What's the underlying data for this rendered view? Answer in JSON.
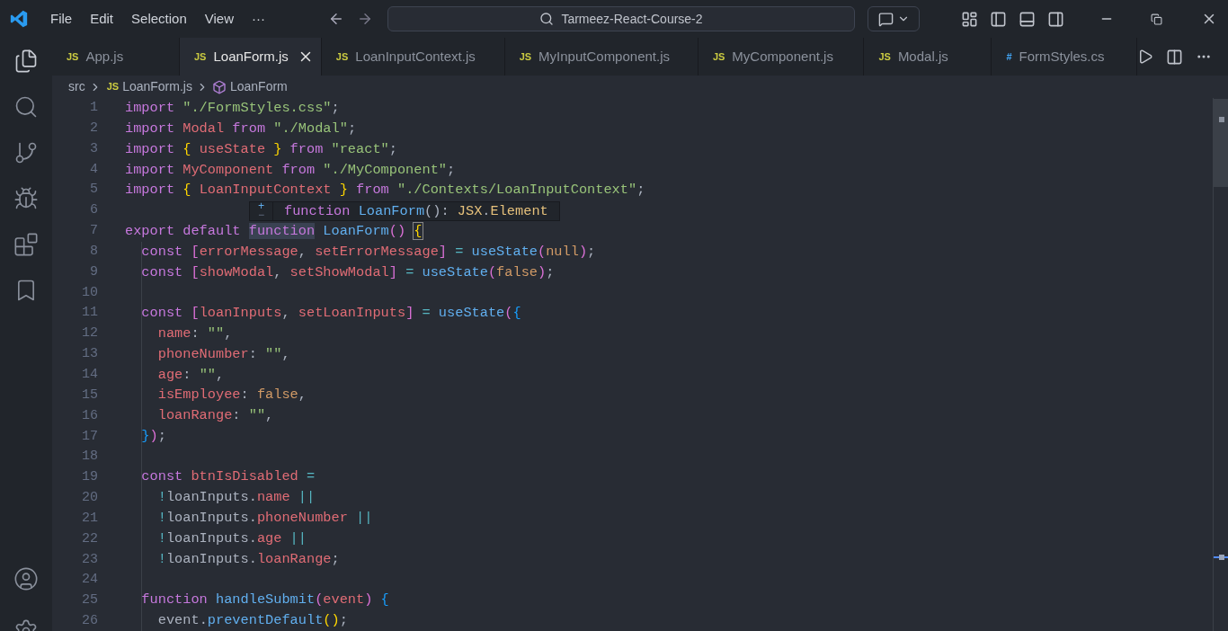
{
  "menu": [
    "File",
    "Edit",
    "Selection",
    "View",
    "···"
  ],
  "command_center": {
    "text": "Tarmeez-React-Course-2"
  },
  "tabs": [
    {
      "icon_text": "JS",
      "kind": "js",
      "label": "App.js",
      "selected": false
    },
    {
      "icon_text": "JS",
      "kind": "js",
      "label": "LoanForm.js",
      "selected": true
    },
    {
      "icon_text": "JS",
      "kind": "js",
      "label": "LoanInputContext.js",
      "selected": false
    },
    {
      "icon_text": "JS",
      "kind": "js",
      "label": "MyInputComponent.js",
      "selected": false
    },
    {
      "icon_text": "JS",
      "kind": "js",
      "label": "MyComponent.js",
      "selected": false
    },
    {
      "icon_text": "JS",
      "kind": "js",
      "label": "Modal.js",
      "selected": false
    },
    {
      "icon_text": "#",
      "kind": "css",
      "label": "FormStyles.cs",
      "selected": false
    }
  ],
  "breadcrumb": {
    "folder": "src",
    "file_icon": "JS",
    "file": "LoanForm.js",
    "symbol": "LoanForm"
  },
  "hover": {
    "plus": "+",
    "minus": "−",
    "tokens": [
      {
        "text": "function ",
        "kind": "keyword"
      },
      {
        "text": "LoanForm",
        "kind": "function"
      },
      {
        "text": "(): ",
        "kind": "plain"
      },
      {
        "text": "JSX",
        "kind": "type"
      },
      {
        "text": ".",
        "kind": "plain"
      },
      {
        "text": "Element",
        "kind": "type"
      }
    ]
  },
  "lines": [
    {
      "number": "1",
      "tokens": [
        {
          "text": "import ",
          "kind": "keyword"
        },
        {
          "text": "\"./FormStyles.css\"",
          "kind": "string"
        },
        {
          "text": ";",
          "kind": "plain"
        }
      ]
    },
    {
      "number": "2",
      "tokens": [
        {
          "text": "import ",
          "kind": "keyword"
        },
        {
          "text": "Modal ",
          "kind": "variable"
        },
        {
          "text": "from ",
          "kind": "keyword"
        },
        {
          "text": "\"./Modal\"",
          "kind": "string"
        },
        {
          "text": ";",
          "kind": "plain"
        }
      ]
    },
    {
      "number": "3",
      "tokens": [
        {
          "text": "import ",
          "kind": "keyword"
        },
        {
          "text": "{ ",
          "kind": "bracket1"
        },
        {
          "text": "useState ",
          "kind": "variable"
        },
        {
          "text": "} ",
          "kind": "bracket1"
        },
        {
          "text": "from ",
          "kind": "keyword"
        },
        {
          "text": "\"react\"",
          "kind": "string"
        },
        {
          "text": ";",
          "kind": "plain"
        }
      ]
    },
    {
      "number": "4",
      "tokens": [
        {
          "text": "import ",
          "kind": "keyword"
        },
        {
          "text": "MyComponent ",
          "kind": "variable"
        },
        {
          "text": "from ",
          "kind": "keyword"
        },
        {
          "text": "\"./MyComponent\"",
          "kind": "string"
        },
        {
          "text": ";",
          "kind": "plain"
        }
      ]
    },
    {
      "number": "5",
      "tokens": [
        {
          "text": "import ",
          "kind": "keyword"
        },
        {
          "text": "{ ",
          "kind": "bracket1"
        },
        {
          "text": "LoanInputContext ",
          "kind": "variable"
        },
        {
          "text": "} ",
          "kind": "bracket1"
        },
        {
          "text": "from ",
          "kind": "keyword"
        },
        {
          "text": "\"./Contexts/LoanInputContext\"",
          "kind": "string"
        },
        {
          "text": ";",
          "kind": "plain"
        }
      ]
    },
    {
      "number": "6"
    },
    {
      "number": "7",
      "tokens": [
        {
          "text": "export ",
          "kind": "keyword"
        },
        {
          "text": "default ",
          "kind": "keyword"
        },
        {
          "text": "function",
          "kind": "keyword",
          "highlighted": true
        },
        {
          "text": " LoanForm",
          "kind": "function"
        },
        {
          "text": "() ",
          "kind": "bracket2"
        },
        {
          "text": "{",
          "kind": "bracket1",
          "matched": true
        }
      ]
    },
    {
      "number": "8",
      "tokens": [
        {
          "text": "  const ",
          "kind": "keyword"
        },
        {
          "text": "[",
          "kind": "bracket2"
        },
        {
          "text": "errorMessage",
          "kind": "variable"
        },
        {
          "text": ", ",
          "kind": "plain"
        },
        {
          "text": "setErrorMessage",
          "kind": "variable"
        },
        {
          "text": "] ",
          "kind": "bracket2"
        },
        {
          "text": "= ",
          "kind": "operator"
        },
        {
          "text": "useState",
          "kind": "function"
        },
        {
          "text": "(",
          "kind": "bracket2"
        },
        {
          "text": "null",
          "kind": "constant"
        },
        {
          "text": ")",
          "kind": "bracket2"
        },
        {
          "text": ";",
          "kind": "plain"
        }
      ]
    },
    {
      "number": "9",
      "tokens": [
        {
          "text": "  const ",
          "kind": "keyword"
        },
        {
          "text": "[",
          "kind": "bracket2"
        },
        {
          "text": "showModal",
          "kind": "variable"
        },
        {
          "text": ", ",
          "kind": "plain"
        },
        {
          "text": "setShowModal",
          "kind": "variable"
        },
        {
          "text": "] ",
          "kind": "bracket2"
        },
        {
          "text": "= ",
          "kind": "operator"
        },
        {
          "text": "useState",
          "kind": "function"
        },
        {
          "text": "(",
          "kind": "bracket2"
        },
        {
          "text": "false",
          "kind": "constant"
        },
        {
          "text": ")",
          "kind": "bracket2"
        },
        {
          "text": ";",
          "kind": "plain"
        }
      ]
    },
    {
      "number": "10"
    },
    {
      "number": "11",
      "tokens": [
        {
          "text": "  const ",
          "kind": "keyword"
        },
        {
          "text": "[",
          "kind": "bracket2"
        },
        {
          "text": "loanInputs",
          "kind": "variable"
        },
        {
          "text": ", ",
          "kind": "plain"
        },
        {
          "text": "setLoanInputs",
          "kind": "variable"
        },
        {
          "text": "] ",
          "kind": "bracket2"
        },
        {
          "text": "= ",
          "kind": "operator"
        },
        {
          "text": "useState",
          "kind": "function"
        },
        {
          "text": "(",
          "kind": "bracket2"
        },
        {
          "text": "{",
          "kind": "bracket3"
        }
      ]
    },
    {
      "number": "12",
      "tokens": [
        {
          "text": "    name",
          "kind": "property"
        },
        {
          "text": ": ",
          "kind": "plain"
        },
        {
          "text": "\"\"",
          "kind": "string"
        },
        {
          "text": ",",
          "kind": "plain"
        }
      ]
    },
    {
      "number": "13",
      "tokens": [
        {
          "text": "    phoneNumber",
          "kind": "property"
        },
        {
          "text": ": ",
          "kind": "plain"
        },
        {
          "text": "\"\"",
          "kind": "string"
        },
        {
          "text": ",",
          "kind": "plain"
        }
      ]
    },
    {
      "number": "14",
      "tokens": [
        {
          "text": "    age",
          "kind": "property"
        },
        {
          "text": ": ",
          "kind": "plain"
        },
        {
          "text": "\"\"",
          "kind": "string"
        },
        {
          "text": ",",
          "kind": "plain"
        }
      ]
    },
    {
      "number": "15",
      "tokens": [
        {
          "text": "    isEmployee",
          "kind": "property"
        },
        {
          "text": ": ",
          "kind": "plain"
        },
        {
          "text": "false",
          "kind": "constant"
        },
        {
          "text": ",",
          "kind": "plain"
        }
      ]
    },
    {
      "number": "16",
      "tokens": [
        {
          "text": "    loanRange",
          "kind": "property"
        },
        {
          "text": ": ",
          "kind": "plain"
        },
        {
          "text": "\"\"",
          "kind": "string"
        },
        {
          "text": ",",
          "kind": "plain"
        }
      ]
    },
    {
      "number": "17",
      "tokens": [
        {
          "text": "  }",
          "kind": "bracket3"
        },
        {
          "text": ")",
          "kind": "bracket2"
        },
        {
          "text": ";",
          "kind": "plain"
        }
      ]
    },
    {
      "number": "18"
    },
    {
      "number": "19",
      "tokens": [
        {
          "text": "  const ",
          "kind": "keyword"
        },
        {
          "text": "btnIsDisabled ",
          "kind": "variable"
        },
        {
          "text": "=",
          "kind": "operator"
        }
      ]
    },
    {
      "number": "20",
      "tokens": [
        {
          "text": "    !",
          "kind": "operator"
        },
        {
          "text": "loanInputs",
          "kind": "plain"
        },
        {
          "text": ".",
          "kind": "plain"
        },
        {
          "text": "name ",
          "kind": "property"
        },
        {
          "text": "||",
          "kind": "operator"
        }
      ]
    },
    {
      "number": "21",
      "tokens": [
        {
          "text": "    !",
          "kind": "operator"
        },
        {
          "text": "loanInputs",
          "kind": "plain"
        },
        {
          "text": ".",
          "kind": "plain"
        },
        {
          "text": "phoneNumber ",
          "kind": "property"
        },
        {
          "text": "||",
          "kind": "operator"
        }
      ]
    },
    {
      "number": "22",
      "tokens": [
        {
          "text": "    !",
          "kind": "operator"
        },
        {
          "text": "loanInputs",
          "kind": "plain"
        },
        {
          "text": ".",
          "kind": "plain"
        },
        {
          "text": "age ",
          "kind": "property"
        },
        {
          "text": "||",
          "kind": "operator"
        }
      ]
    },
    {
      "number": "23",
      "tokens": [
        {
          "text": "    !",
          "kind": "operator"
        },
        {
          "text": "loanInputs",
          "kind": "plain"
        },
        {
          "text": ".",
          "kind": "plain"
        },
        {
          "text": "loanRange",
          "kind": "property"
        },
        {
          "text": ";",
          "kind": "plain"
        }
      ]
    },
    {
      "number": "24"
    },
    {
      "number": "25",
      "tokens": [
        {
          "text": "  function ",
          "kind": "keyword"
        },
        {
          "text": "handleSubmit",
          "kind": "function"
        },
        {
          "text": "(",
          "kind": "bracket2"
        },
        {
          "text": "event",
          "kind": "variable"
        },
        {
          "text": ") ",
          "kind": "bracket2"
        },
        {
          "text": "{",
          "kind": "bracket3"
        }
      ]
    },
    {
      "number": "26",
      "tokens": [
        {
          "text": "    event",
          "kind": "plain"
        },
        {
          "text": ".",
          "kind": "plain"
        },
        {
          "text": "preventDefault",
          "kind": "function"
        },
        {
          "text": "()",
          "kind": "bracket1"
        },
        {
          "text": ";",
          "kind": "plain"
        }
      ]
    }
  ]
}
